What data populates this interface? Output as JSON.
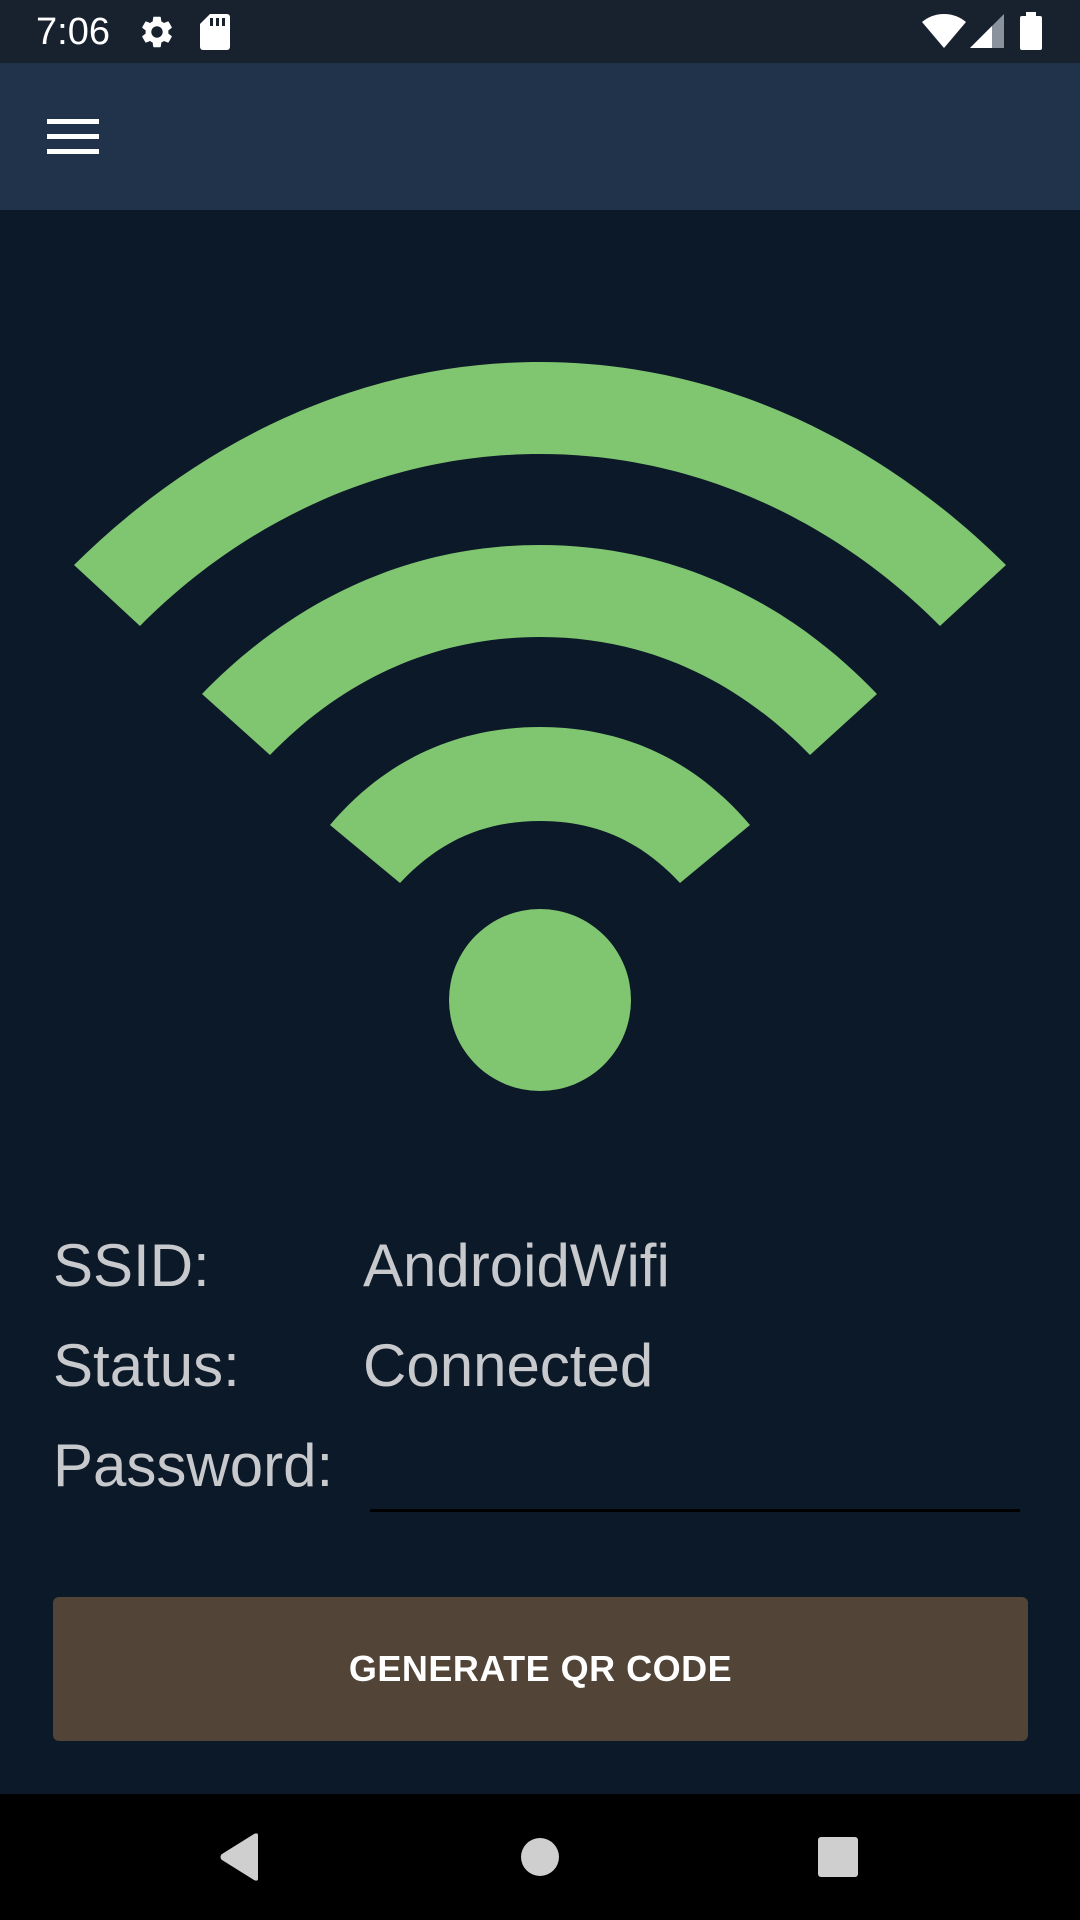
{
  "status_bar": {
    "time": "7:06",
    "icons": [
      "settings-icon",
      "sd-card-icon",
      "wifi-signal-icon",
      "cell-signal-icon",
      "battery-icon"
    ]
  },
  "app_bar": {
    "menu_icon": "hamburger-menu-icon"
  },
  "hero": {
    "icon": "wifi-icon",
    "color": "#80c56f"
  },
  "info": {
    "ssid_label": "SSID:",
    "ssid_value": "AndroidWifi",
    "status_label": "Status:",
    "status_value": "Connected",
    "password_label": "Password:",
    "password_value": ""
  },
  "actions": {
    "generate_label": "GENERATE QR CODE"
  },
  "nav_bar": {
    "icons": [
      "back-icon",
      "home-icon",
      "recents-icon"
    ]
  },
  "colors": {
    "background": "#0b1929",
    "app_bar": "#21324b",
    "status_bar": "#18222f",
    "accent_green": "#80c56f",
    "button": "#524537",
    "text": "#c7c9cc"
  }
}
